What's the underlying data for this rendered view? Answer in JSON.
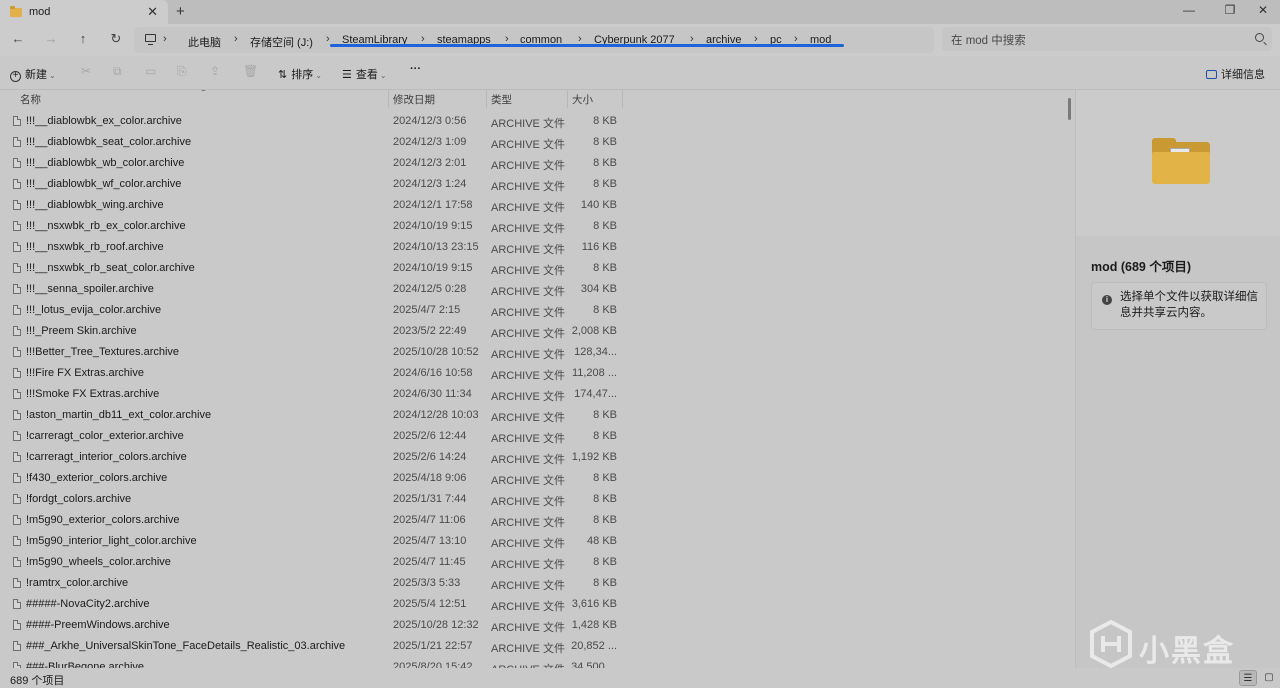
{
  "window": {
    "tab_title": "mod",
    "tab_close": "✕",
    "tab_add": "+",
    "minimize": "—",
    "restore": "❐",
    "close": "✕"
  },
  "nav": {
    "back": "←",
    "forward": "→",
    "up": "↑",
    "refresh": "↻",
    "breadcrumbs": [
      "此电脑",
      "存储空间 (J:)",
      "SteamLibrary",
      "steamapps",
      "common",
      "Cyberpunk 2077",
      "archive",
      "pc",
      "mod"
    ],
    "separator": "›",
    "search_placeholder": "在 mod 中搜索"
  },
  "toolbar": {
    "new_label": "新建",
    "sort_label": "排序",
    "view_label": "查看",
    "more_label": "···",
    "details_label": "详细信息"
  },
  "columns": {
    "name": "名称",
    "date": "修改日期",
    "type": "类型",
    "size": "大小"
  },
  "files": [
    {
      "name": "!!!__diablowbk_ex_color.archive",
      "date": "2024/12/3 0:56",
      "type": "ARCHIVE 文件",
      "size": "8 KB"
    },
    {
      "name": "!!!__diablowbk_seat_color.archive",
      "date": "2024/12/3 1:09",
      "type": "ARCHIVE 文件",
      "size": "8 KB"
    },
    {
      "name": "!!!__diablowbk_wb_color.archive",
      "date": "2024/12/3 2:01",
      "type": "ARCHIVE 文件",
      "size": "8 KB"
    },
    {
      "name": "!!!__diablowbk_wf_color.archive",
      "date": "2024/12/3 1:24",
      "type": "ARCHIVE 文件",
      "size": "8 KB"
    },
    {
      "name": "!!!__diablowbk_wing.archive",
      "date": "2024/12/1 17:58",
      "type": "ARCHIVE 文件",
      "size": "140 KB"
    },
    {
      "name": "!!!__nsxwbk_rb_ex_color.archive",
      "date": "2024/10/19 9:15",
      "type": "ARCHIVE 文件",
      "size": "8 KB"
    },
    {
      "name": "!!!__nsxwbk_rb_roof.archive",
      "date": "2024/10/13 23:15",
      "type": "ARCHIVE 文件",
      "size": "116 KB"
    },
    {
      "name": "!!!__nsxwbk_rb_seat_color.archive",
      "date": "2024/10/19 9:15",
      "type": "ARCHIVE 文件",
      "size": "8 KB"
    },
    {
      "name": "!!!__senna_spoiler.archive",
      "date": "2024/12/5 0:28",
      "type": "ARCHIVE 文件",
      "size": "304 KB"
    },
    {
      "name": "!!!_lotus_evija_color.archive",
      "date": "2025/4/7 2:15",
      "type": "ARCHIVE 文件",
      "size": "8 KB"
    },
    {
      "name": "!!!_Preem Skin.archive",
      "date": "2023/5/2 22:49",
      "type": "ARCHIVE 文件",
      "size": "2,008 KB"
    },
    {
      "name": "!!!Better_Tree_Textures.archive",
      "date": "2025/10/28 10:52",
      "type": "ARCHIVE 文件",
      "size": "128,34..."
    },
    {
      "name": "!!!Fire FX Extras.archive",
      "date": "2024/6/16 10:58",
      "type": "ARCHIVE 文件",
      "size": "11,208 ..."
    },
    {
      "name": "!!!Smoke FX Extras.archive",
      "date": "2024/6/30 11:34",
      "type": "ARCHIVE 文件",
      "size": "174,47..."
    },
    {
      "name": "!aston_martin_db11_ext_color.archive",
      "date": "2024/12/28 10:03",
      "type": "ARCHIVE 文件",
      "size": "8 KB"
    },
    {
      "name": "!carreragt_color_exterior.archive",
      "date": "2025/2/6 12:44",
      "type": "ARCHIVE 文件",
      "size": "8 KB"
    },
    {
      "name": "!carreragt_interior_colors.archive",
      "date": "2025/2/6 14:24",
      "type": "ARCHIVE 文件",
      "size": "1,192 KB"
    },
    {
      "name": "!f430_exterior_colors.archive",
      "date": "2025/4/18 9:06",
      "type": "ARCHIVE 文件",
      "size": "8 KB"
    },
    {
      "name": "!fordgt_colors.archive",
      "date": "2025/1/31 7:44",
      "type": "ARCHIVE 文件",
      "size": "8 KB"
    },
    {
      "name": "!m5g90_exterior_colors.archive",
      "date": "2025/4/7 11:06",
      "type": "ARCHIVE 文件",
      "size": "8 KB"
    },
    {
      "name": "!m5g90_interior_light_color.archive",
      "date": "2025/4/7 13:10",
      "type": "ARCHIVE 文件",
      "size": "48 KB"
    },
    {
      "name": "!m5g90_wheels_color.archive",
      "date": "2025/4/7 11:45",
      "type": "ARCHIVE 文件",
      "size": "8 KB"
    },
    {
      "name": "!ramtrx_color.archive",
      "date": "2025/3/3 5:33",
      "type": "ARCHIVE 文件",
      "size": "8 KB"
    },
    {
      "name": "#####-NovaCity2.archive",
      "date": "2025/5/4 12:51",
      "type": "ARCHIVE 文件",
      "size": "3,616 KB"
    },
    {
      "name": "####-PreemWindows.archive",
      "date": "2025/10/28 12:32",
      "type": "ARCHIVE 文件",
      "size": "1,428 KB"
    },
    {
      "name": "###_Arkhe_UniversalSkinTone_FaceDetails_Realistic_03.archive",
      "date": "2025/1/21 22:57",
      "type": "ARCHIVE 文件",
      "size": "20,852 ..."
    },
    {
      "name": "###-BlurBegone.archive",
      "date": "2025/8/20 15:42",
      "type": "ARCHIVE 文件",
      "size": "34,500 ..."
    }
  ],
  "details": {
    "title": "mod (689 个项目)",
    "message": "选择单个文件以获取详细信息并共享云内容。"
  },
  "status": {
    "count": "689 个项目"
  },
  "watermark": {
    "text": "小黑盒"
  },
  "colors": {
    "accent_underline": "#1e63d8",
    "folder": "#e2b347"
  }
}
